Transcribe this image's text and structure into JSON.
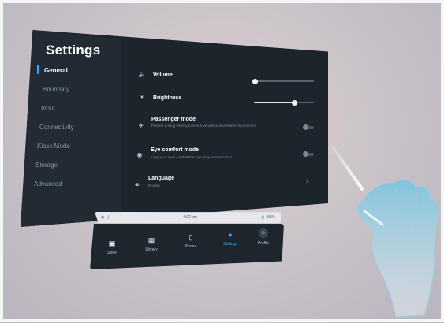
{
  "settings": {
    "title": "Settings",
    "sidebar": {
      "items": [
        {
          "label": "General",
          "active": true
        },
        {
          "label": "Boundary"
        },
        {
          "label": "Input"
        },
        {
          "label": "Connectivity"
        },
        {
          "label": "Kiosk Mode"
        },
        {
          "label": "Storage"
        },
        {
          "label": "Advanced"
        }
      ]
    },
    "rows": {
      "volume": {
        "label": "Volume",
        "icon": "speaker-icon",
        "level": 0.0
      },
      "brightness": {
        "label": "Brightness",
        "icon": "sun-icon",
        "level": 0.72
      },
      "passenger": {
        "label": "Passenger mode",
        "desc": "Prevent drifting when you're in a vehicle or less stable environment",
        "icon": "car-icon",
        "enabled": false
      },
      "eye_comfort": {
        "label": "Eye comfort mode",
        "desc": "Keep your eyes comfortable by using warmer colors",
        "icon": "eye-icon",
        "enabled": false
      },
      "language": {
        "label": "Language",
        "value": "English",
        "icon": "globe-icon"
      }
    }
  },
  "status": {
    "time": "4:02 pm",
    "battery": "58%",
    "wifi_icon": "wifi-icon",
    "bluetooth_icon": "bluetooth-icon"
  },
  "dock": {
    "items": [
      {
        "label": "Store",
        "icon": "store-icon"
      },
      {
        "label": "Library",
        "icon": "library-icon"
      },
      {
        "label": "Phone",
        "icon": "phone-icon"
      },
      {
        "label": "Settings",
        "icon": "gear-icon",
        "active": true
      },
      {
        "label": "Profile",
        "icon": "profile-icon"
      }
    ]
  },
  "colors": {
    "accent": "#3aa8ff",
    "panel": "#1c242c"
  }
}
